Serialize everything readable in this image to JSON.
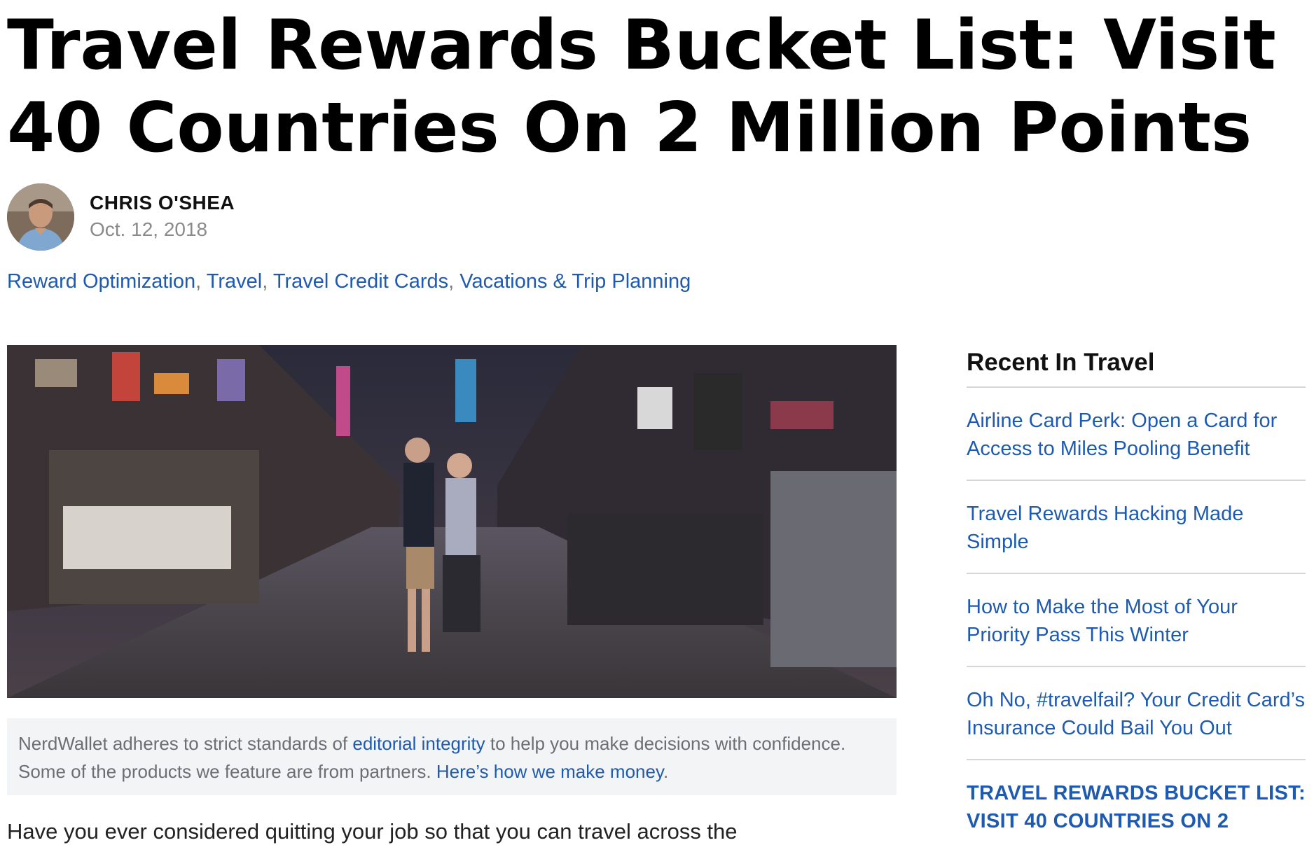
{
  "article": {
    "title": "Travel Rewards Bucket List: Visit 40 Countries On 2 Million Points",
    "author": "CHRIS O'SHEA",
    "date": "Oct. 12, 2018",
    "tags": [
      "Reward Optimization",
      "Travel",
      "Travel Credit Cards",
      "Vacations & Trip Planning"
    ],
    "tag_separator": ", ",
    "disclaimer": {
      "part1": "NerdWallet adheres to strict standards of ",
      "link1": "editorial integrity",
      "part2": " to help you make decisions with confidence. Some of the products we feature are from partners. ",
      "link2": "Here’s how we make money",
      "part3": "."
    },
    "first_line": "Have you ever considered quitting your job so that you can travel across the"
  },
  "sidebar": {
    "title": "Recent In Travel",
    "items": [
      "Airline Card Perk: Open a Card for Access to Miles Pooling Benefit",
      "Travel Rewards Hacking Made Simple",
      "How to Make the Most of Your Priority Pass This Winter",
      "Oh No, #travelfail? Your Credit Card’s Insurance Could Bail You Out"
    ],
    "current": "TRAVEL REWARDS BUCKET LIST: VISIT 40 COUNTRIES ON 2"
  },
  "colors": {
    "link": "#1e5bb0",
    "disclaimer_bg": "#f3f4f6",
    "muted": "#8a8a8a"
  }
}
